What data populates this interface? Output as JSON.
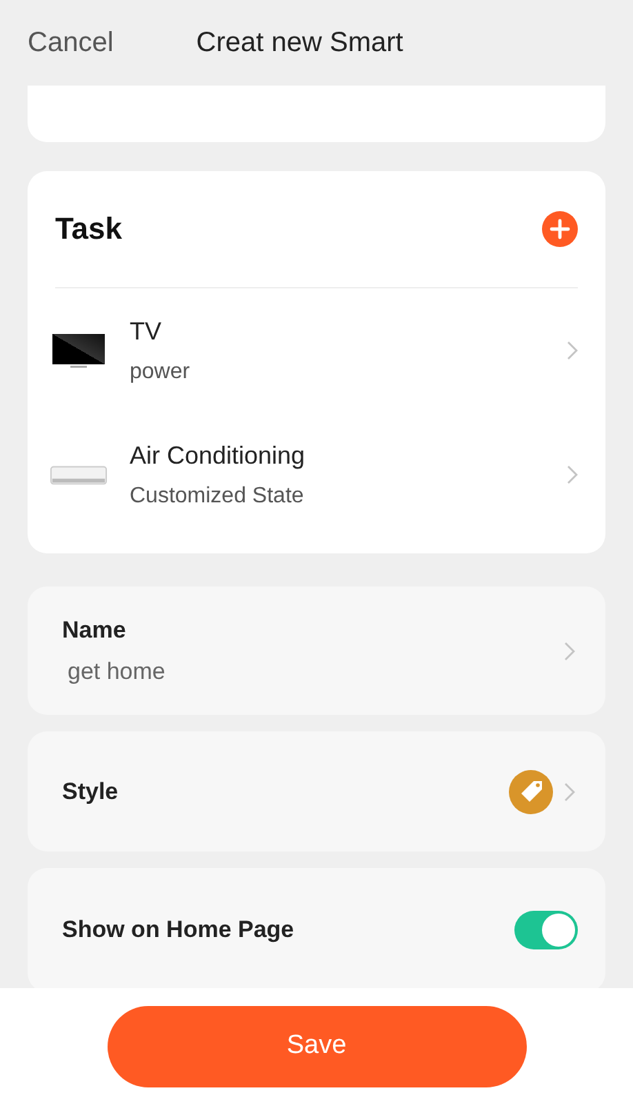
{
  "nav": {
    "cancel": "Cancel",
    "title": "Creat new Smart"
  },
  "task": {
    "title": "Task",
    "items": [
      {
        "kind": "tv",
        "name": "TV",
        "detail": "power"
      },
      {
        "kind": "ac",
        "name": "Air Conditioning",
        "detail": "Customized State"
      }
    ]
  },
  "settings": [
    {
      "kind": "value",
      "label": "Name",
      "value": "get home"
    },
    {
      "kind": "tag",
      "label": "Style",
      "color": "#d9952a"
    },
    {
      "kind": "toggle",
      "label": "Show on Home Page",
      "on": true
    }
  ],
  "save": "Save"
}
